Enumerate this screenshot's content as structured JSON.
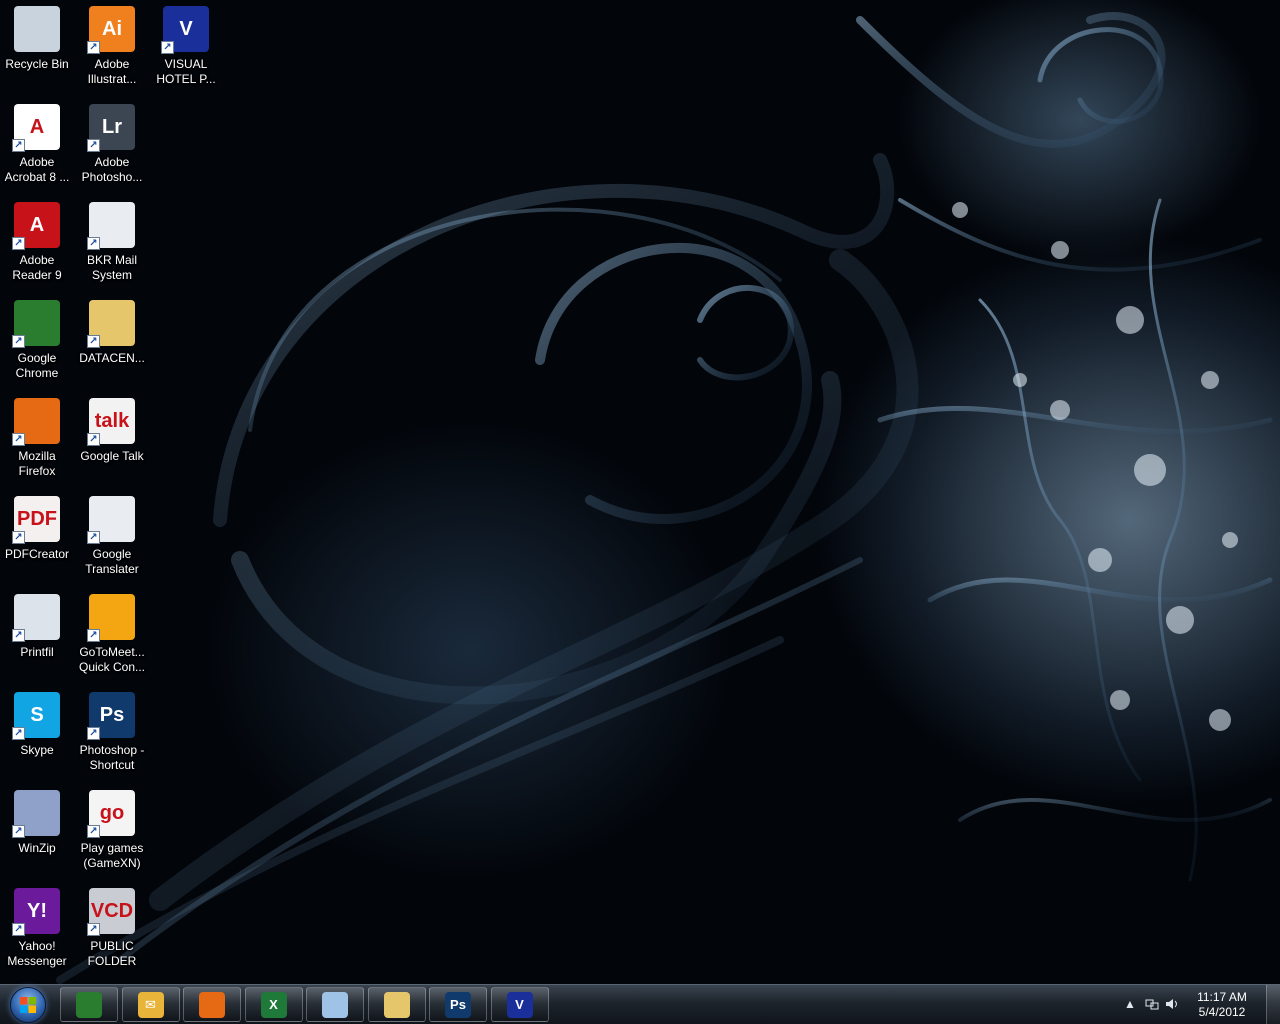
{
  "desktop_icons": [
    {
      "label": "Recycle Bin",
      "glyph": "",
      "icon": "recycle-bin-icon",
      "color": "#c9d3dd",
      "shortcut": false
    },
    {
      "label": "Adobe\nIllustrat...",
      "glyph": "Ai",
      "icon": "adobe-illustrator-icon",
      "color": "#f07f1d",
      "shortcut": true
    },
    {
      "label": "VISUAL\nHOTEL P...",
      "glyph": "V",
      "icon": "visual-hotel-icon",
      "color": "#1a2f9a",
      "shortcut": true
    },
    {
      "label": "Adobe\nAcrobat 8 ...",
      "glyph": "A",
      "icon": "adobe-acrobat-icon",
      "color": "#ffffff",
      "shortcut": true
    },
    {
      "label": "Adobe\nPhotosho...",
      "glyph": "Lr",
      "icon": "adobe-lightroom-icon",
      "color": "#3c4652",
      "shortcut": true
    },
    {
      "label": "Adobe\nReader 9",
      "glyph": "A",
      "icon": "adobe-reader-icon",
      "color": "#c8121a",
      "shortcut": true
    },
    {
      "label": "BKR Mail\nSystem",
      "glyph": "",
      "icon": "firefox-document-icon",
      "color": "#e9edf2",
      "shortcut": true
    },
    {
      "label": "Google\nChrome",
      "glyph": "",
      "icon": "google-chrome-icon",
      "color": "#2a7d2e",
      "shortcut": true
    },
    {
      "label": "DATACEN...",
      "glyph": "",
      "icon": "folder-icon",
      "color": "#e6c66a",
      "shortcut": true
    },
    {
      "label": "Mozilla\nFirefox",
      "glyph": "",
      "icon": "firefox-icon",
      "color": "#e56a13",
      "shortcut": true
    },
    {
      "label": "Google Talk",
      "glyph": "talk",
      "icon": "google-talk-icon",
      "color": "#f2f2f2",
      "shortcut": true
    },
    {
      "label": "PDFCreator",
      "glyph": "PDF",
      "icon": "pdfcreator-icon",
      "color": "#f4f0f0",
      "shortcut": true
    },
    {
      "label": "Google\nTranslater",
      "glyph": "",
      "icon": "firefox-document-icon",
      "color": "#e9edf2",
      "shortcut": true
    },
    {
      "label": "Printfil",
      "glyph": "",
      "icon": "printer-icon",
      "color": "#dde3ea",
      "shortcut": true
    },
    {
      "label": "GoToMeet...\nQuick Con...",
      "glyph": "",
      "icon": "gotomeeting-icon",
      "color": "#f4a512",
      "shortcut": true
    },
    {
      "label": "Skype",
      "glyph": "S",
      "icon": "skype-icon",
      "color": "#12a5e3",
      "shortcut": true
    },
    {
      "label": "Photoshop -\nShortcut",
      "glyph": "Ps",
      "icon": "photoshop-icon",
      "color": "#0f3a6b",
      "shortcut": true
    },
    {
      "label": "WinZip",
      "glyph": "",
      "icon": "winzip-icon",
      "color": "#8fa0c9",
      "shortcut": true
    },
    {
      "label": "Play games\n(GameXN)",
      "glyph": "go",
      "icon": "gamexn-icon",
      "color": "#f4f4f4",
      "shortcut": true
    },
    {
      "label": "Yahoo!\nMessenger",
      "glyph": "Y!",
      "icon": "yahoo-messenger-icon",
      "color": "#6a1a9a",
      "shortcut": true
    },
    {
      "label": "PUBLIC\nFOLDER",
      "glyph": "VCD",
      "icon": "vcd-disc-icon",
      "color": "#c9cdd3",
      "shortcut": true
    }
  ],
  "taskbar": {
    "start_label": "Start",
    "pinned": [
      {
        "icon": "google-chrome-icon",
        "color": "#2a7d2e",
        "glyph": ""
      },
      {
        "icon": "outlook-icon",
        "color": "#e8b43a",
        "glyph": "✉"
      },
      {
        "icon": "firefox-icon",
        "color": "#e56a13",
        "glyph": ""
      },
      {
        "icon": "excel-icon",
        "color": "#1f7a3a",
        "glyph": "X"
      },
      {
        "icon": "notepad-icon",
        "color": "#9ec3e6",
        "glyph": ""
      },
      {
        "icon": "windows-explorer-icon",
        "color": "#e6c66a",
        "glyph": ""
      },
      {
        "icon": "photoshop-icon",
        "color": "#0f3a6b",
        "glyph": "Ps"
      },
      {
        "icon": "visual-hotel-icon",
        "color": "#1a2f9a",
        "glyph": "V"
      }
    ],
    "clock_time": "11:17 AM",
    "clock_date": "5/4/2012"
  }
}
